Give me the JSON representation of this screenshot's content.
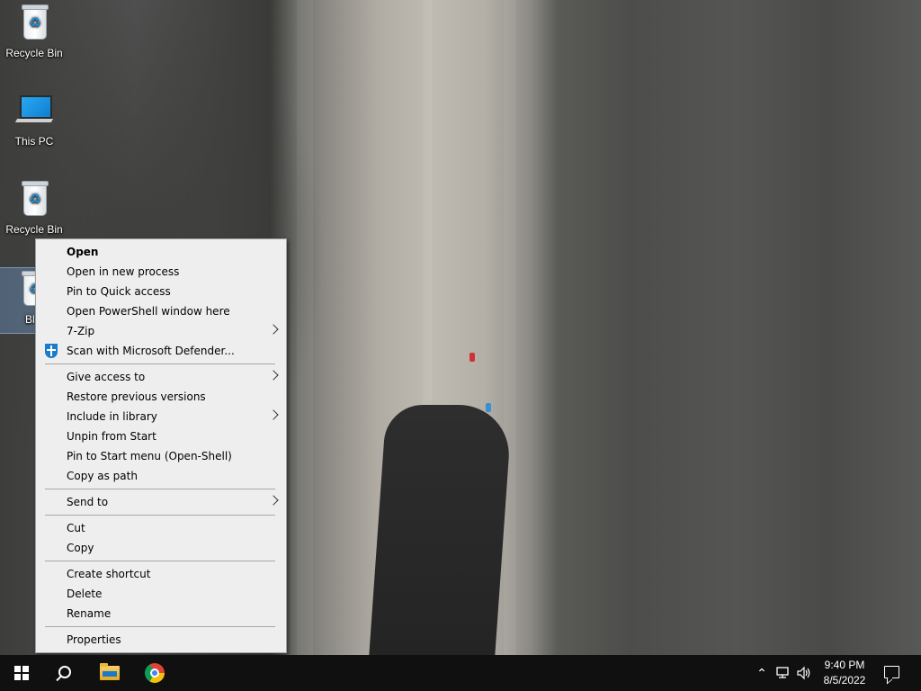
{
  "desktop": {
    "icons": [
      {
        "label": "Recycle Bin",
        "icon": "recycle-bin-icon"
      },
      {
        "label": "This PC",
        "icon": "computer-icon"
      },
      {
        "label": "Recycle Bin",
        "icon": "recycle-bin-icon"
      },
      {
        "label": "Bl",
        "icon": "recycle-bin-icon"
      }
    ]
  },
  "context_menu": {
    "groups": [
      [
        {
          "label": "Open",
          "bold": true
        },
        {
          "label": "Open in new process"
        },
        {
          "label": "Pin to Quick access"
        },
        {
          "label": "Open PowerShell window here"
        },
        {
          "label": "7-Zip",
          "submenu": true
        },
        {
          "label": "Scan with Microsoft Defender...",
          "icon": "defender-shield-icon"
        }
      ],
      [
        {
          "label": "Give access to",
          "submenu": true
        },
        {
          "label": "Restore previous versions"
        },
        {
          "label": "Include in library",
          "submenu": true
        },
        {
          "label": "Unpin from Start"
        },
        {
          "label": "Pin to Start menu (Open-Shell)"
        },
        {
          "label": "Copy as path"
        }
      ],
      [
        {
          "label": "Send to",
          "submenu": true
        }
      ],
      [
        {
          "label": "Cut"
        },
        {
          "label": "Copy"
        }
      ],
      [
        {
          "label": "Create shortcut"
        },
        {
          "label": "Delete"
        },
        {
          "label": "Rename"
        }
      ],
      [
        {
          "label": "Properties"
        }
      ]
    ]
  },
  "taskbar": {
    "buttons": [
      "start-button",
      "search-button",
      "file-explorer-button",
      "chrome-button"
    ],
    "tray_icons": [
      "show-hidden-icons-chevron-icon",
      "network-icon",
      "volume-icon"
    ],
    "clock": {
      "time": "9:40 PM",
      "date": "8/5/2022"
    },
    "notification_icon": "action-center-icon"
  }
}
